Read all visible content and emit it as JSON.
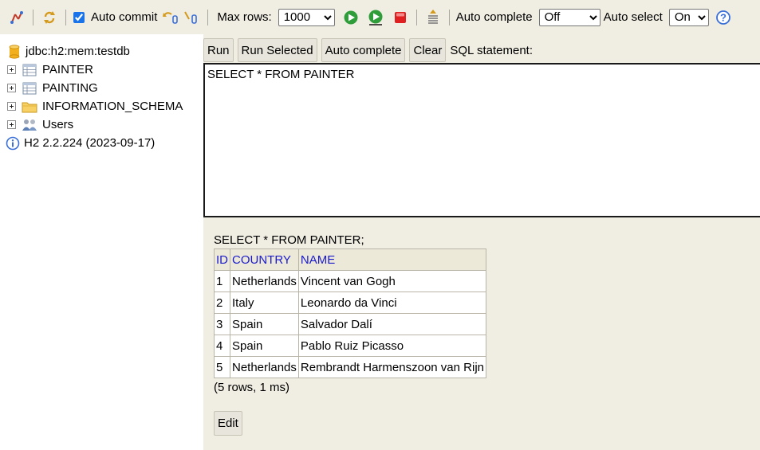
{
  "toolbar": {
    "auto_commit_label": "Auto commit",
    "auto_commit_checked": true,
    "max_rows_label": "Max rows:",
    "max_rows_value": "1000",
    "auto_complete_label": "Auto complete",
    "auto_complete_value": "Off",
    "auto_select_label": "Auto select",
    "auto_select_value": "On",
    "icons": [
      "disconnect-icon",
      "refresh-icon",
      "rollback-icon",
      "commit-icon",
      "run-icon",
      "run-selected-icon",
      "cancel-icon",
      "history-icon",
      "help-icon"
    ]
  },
  "tree": {
    "connection": "jdbc:h2:mem:testdb",
    "items": [
      {
        "label": "PAINTER",
        "icon": "table-icon"
      },
      {
        "label": "PAINTING",
        "icon": "table-icon"
      },
      {
        "label": "INFORMATION_SCHEMA",
        "icon": "folder-icon"
      },
      {
        "label": "Users",
        "icon": "users-icon"
      }
    ],
    "version": "H2 2.2.224 (2023-09-17)"
  },
  "editor": {
    "buttons": {
      "run": "Run",
      "run_selected": "Run Selected",
      "auto_complete": "Auto complete",
      "clear": "Clear"
    },
    "sql_label": "SQL statement:",
    "sql_text": "SELECT * FROM PAINTER"
  },
  "result": {
    "query": "SELECT * FROM PAINTER;",
    "columns": [
      "ID",
      "COUNTRY",
      "NAME"
    ],
    "rows": [
      [
        "1",
        "Netherlands",
        "Vincent van Gogh"
      ],
      [
        "2",
        "Italy",
        "Leonardo da Vinci"
      ],
      [
        "3",
        "Spain",
        "Salvador Dalí"
      ],
      [
        "4",
        "Spain",
        "Pablo Ruiz Picasso"
      ],
      [
        "5",
        "Netherlands",
        "Rembrandt Harmenszoon van Rijn"
      ]
    ],
    "summary": "(5 rows, 1 ms)",
    "edit_label": "Edit"
  },
  "colors": {
    "panel_bg": "#f0ede2",
    "header_text": "#1a1acc",
    "run_green": "#2e9d3a",
    "stop_red": "#e02020"
  }
}
